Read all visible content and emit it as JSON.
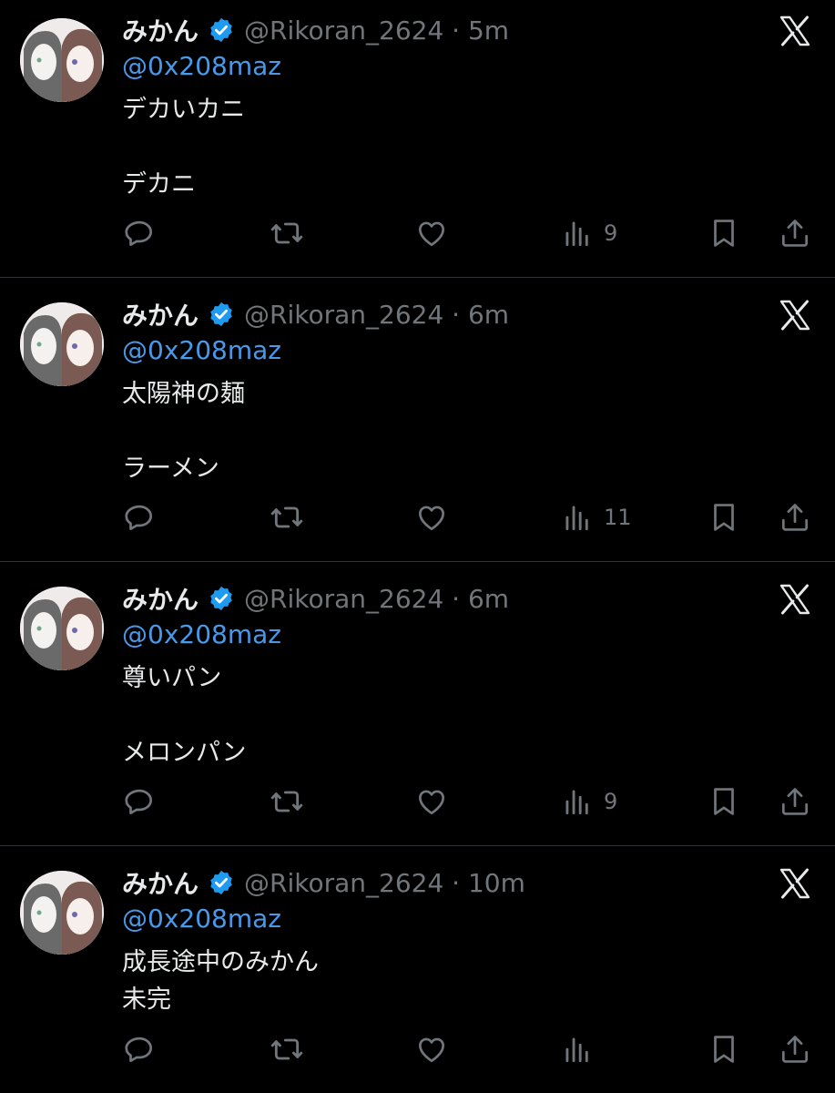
{
  "colors": {
    "background": "#000000",
    "text": "#e7e9ea",
    "secondary": "#71767b",
    "mention": "#4a99e9",
    "verified": "#1d9bf0",
    "divider": "#2f3336"
  },
  "icons": {
    "reply": "reply-icon",
    "retweet": "retweet-icon",
    "like": "like-icon",
    "views": "views-icon",
    "bookmark": "bookmark-icon",
    "share": "share-icon",
    "verified": "verified-badge-icon",
    "logo": "x-logo-icon"
  },
  "tweets": [
    {
      "name": "みかん",
      "handle_time": "@Rikoran_2624 · 5m",
      "mention": "@0x208maz",
      "lines": [
        "デカいカニ",
        "",
        "デカニ"
      ],
      "views": "9"
    },
    {
      "name": "みかん",
      "handle_time": "@Rikoran_2624 · 6m",
      "mention": "@0x208maz",
      "lines": [
        "太陽神の麺",
        "",
        "ラーメン"
      ],
      "views": "11"
    },
    {
      "name": "みかん",
      "handle_time": "@Rikoran_2624 · 6m",
      "mention": "@0x208maz",
      "lines": [
        "尊いパン",
        "",
        "メロンパン"
      ],
      "views": "9"
    },
    {
      "name": "みかん",
      "handle_time": "@Rikoran_2624 · 10m",
      "mention": "@0x208maz",
      "lines": [
        "成長途中のみかん",
        "未完"
      ],
      "views": ""
    }
  ]
}
